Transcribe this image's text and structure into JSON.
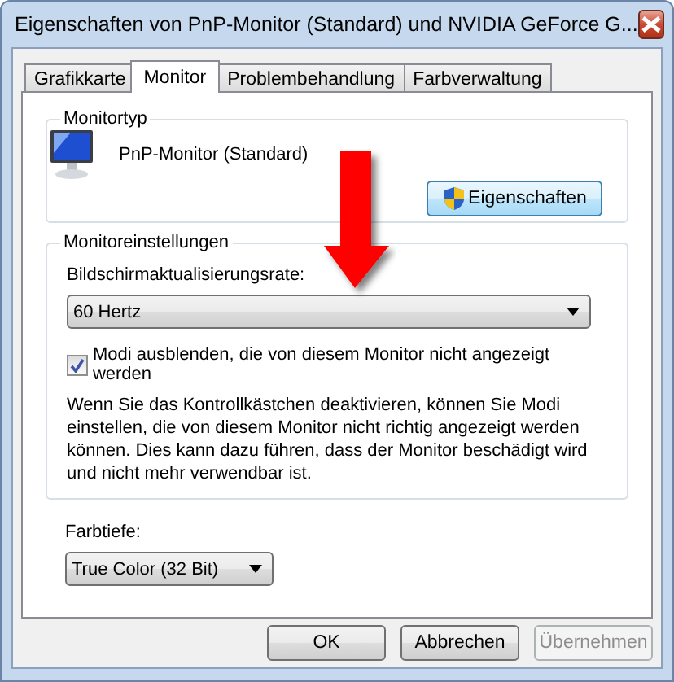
{
  "window": {
    "title": "Eigenschaften von PnP-Monitor (Standard) und NVIDIA GeForce G..."
  },
  "tabs": [
    {
      "label": "Grafikkarte",
      "selected": false
    },
    {
      "label": "Monitor",
      "selected": true
    },
    {
      "label": "Problembehandlung",
      "selected": false
    },
    {
      "label": "Farbverwaltung",
      "selected": false
    }
  ],
  "monitor_type": {
    "legend": "Monitortyp",
    "name": "PnP-Monitor (Standard)",
    "button": "Eigenschaften"
  },
  "monitor_settings": {
    "legend": "Monitoreinstellungen",
    "refresh_label": "Bildschirmaktualisierungsrate:",
    "refresh_value": "60 Hertz",
    "checkbox": {
      "label": "Modi ausblenden, die von diesem Monitor nicht angezeigt werden",
      "checked": true
    },
    "description": "Wenn Sie das Kontrollkästchen deaktivieren, können Sie Modi einstellen, die von diesem Monitor nicht richtig angezeigt werden können. Dies kann dazu führen, dass der Monitor beschädigt wird und nicht mehr verwendbar ist."
  },
  "color_depth": {
    "label": "Farbtiefe:",
    "value": "True Color (32 Bit)"
  },
  "buttons": [
    {
      "label": "OK",
      "disabled": false
    },
    {
      "label": "Abbrechen",
      "disabled": false
    },
    {
      "label": "Übernehmen",
      "disabled": true
    }
  ]
}
